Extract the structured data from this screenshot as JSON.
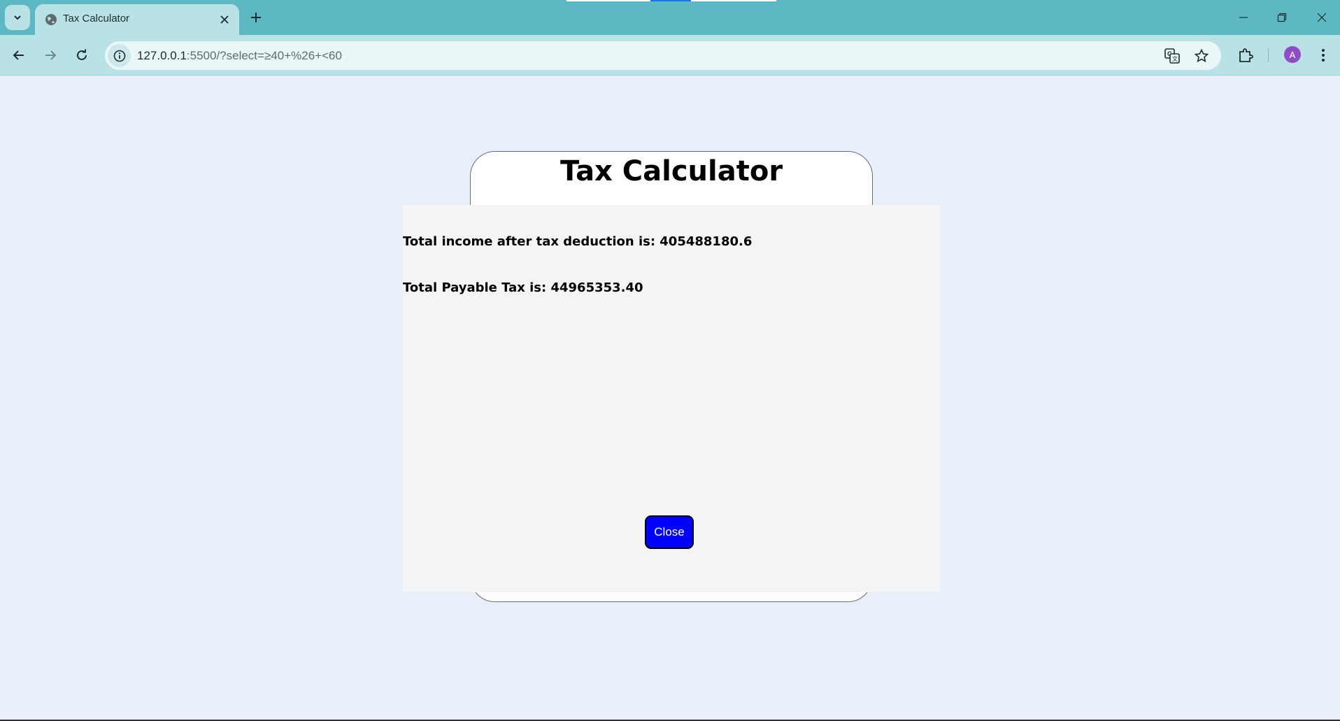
{
  "browser": {
    "tab_title": "Tax Calculator",
    "url_host": "127.0.0.1",
    "url_rest": ":5500/?select=≥40+%26+<60",
    "profile_initial": "A"
  },
  "page": {
    "title": "Tax Calculator",
    "results": {
      "income_after_tax_text": "Total income after tax deduction is: 405488180.6",
      "payable_tax_text": "Total Payable Tax is: 44965353.40"
    },
    "close_label": "Close"
  },
  "colors": {
    "tabstrip": "#5cb8c2",
    "toolbar": "#b9e2e6",
    "page_background": "#e9eff9",
    "modal_background": "#f4f4f4",
    "close_button": "#0000ff",
    "avatar": "#8e4cc4"
  }
}
